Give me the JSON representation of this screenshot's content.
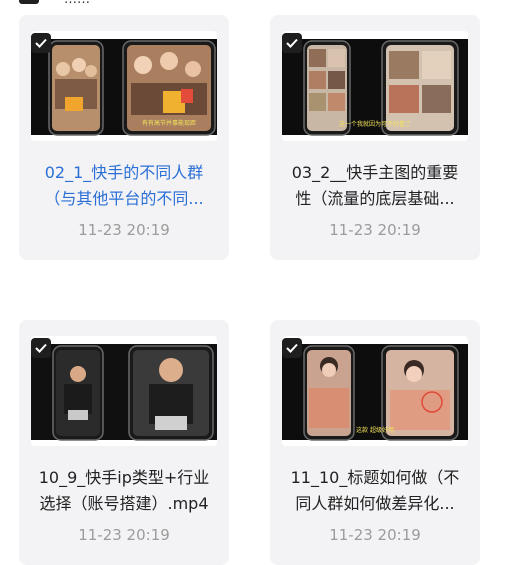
{
  "header": {
    "label": "……"
  },
  "files": [
    {
      "title_line1": "02_1_快手的不同人群",
      "title_line2": "（与其他平台的不同...",
      "time": "11-23 20:19",
      "checked": true,
      "active": true,
      "thumb_caption": "有有高节并事能现距"
    },
    {
      "title_line1": "03_2__快手主图的重要",
      "title_line2": "性（流量的底层基础...",
      "time": "11-23 20:19",
      "checked": true,
      "active": false,
      "thumb_caption": "这一个我就因为可不好看了"
    },
    {
      "title_line1": "10_9_快手ip类型+行业",
      "title_line2": "选择（账号搭建）.mp4",
      "time": "11-23 20:19",
      "checked": true,
      "active": false,
      "thumb_caption": ""
    },
    {
      "title_line1": "11_10_标题如何做（不",
      "title_line2": "同人群如何做差异化...",
      "time": "11-23 20:19",
      "checked": true,
      "active": false,
      "thumb_caption": "这款 超级好用"
    }
  ],
  "colors": {
    "card_bg": "#f3f3f5",
    "active_title": "#2b6fd6",
    "time_text": "#9b9b9b",
    "checkbox_bg": "#1e1e1e"
  },
  "icons": {
    "checkbox": "check-icon"
  }
}
